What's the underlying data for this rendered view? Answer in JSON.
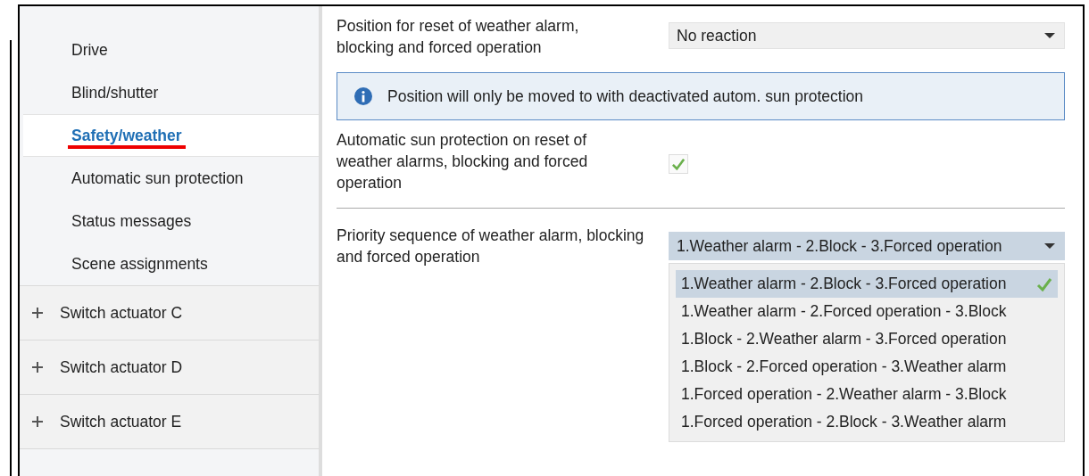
{
  "sidebar": {
    "items": [
      {
        "label": "Drive",
        "kind": "sub",
        "selected": false
      },
      {
        "label": "Blind/shutter",
        "kind": "sub",
        "selected": false
      },
      {
        "label": "Safety/weather",
        "kind": "sub",
        "selected": true
      },
      {
        "label": "Automatic sun protection",
        "kind": "sub",
        "selected": false
      },
      {
        "label": "Status messages",
        "kind": "sub",
        "selected": false
      },
      {
        "label": "Scene assignments",
        "kind": "sub",
        "selected": false
      },
      {
        "label": "Switch actuator C",
        "kind": "group",
        "selected": false,
        "expanded": false
      },
      {
        "label": "Switch actuator D",
        "kind": "group",
        "selected": false,
        "expanded": false
      },
      {
        "label": "Switch actuator E",
        "kind": "group",
        "selected": false,
        "expanded": false
      }
    ]
  },
  "groups": [
    [
      {
        "kind": "dropdown",
        "label": "Position for reset of weather alarm, blocking and forced operation",
        "value": "No reaction",
        "open": false
      },
      {
        "kind": "info",
        "text": "Position will only be moved to with deactivated autom. sun protection"
      },
      {
        "kind": "checkbox",
        "label": "Automatic sun protection on reset of weather alarms, blocking and forced operation",
        "checked": true
      }
    ],
    [
      {
        "kind": "dropdown",
        "label": "Priority sequence of weather alarm, blocking and forced operation",
        "value": "1.Weather alarm - 2.Block - 3.Forced operation",
        "open": true,
        "options": [
          {
            "label": "1.Weather alarm - 2.Block - 3.Forced operation",
            "selected": true
          },
          {
            "label": "1.Weather alarm - 2.Forced operation - 3.Block",
            "selected": false
          },
          {
            "label": "1.Block - 2.Weather alarm - 3.Forced operation",
            "selected": false
          },
          {
            "label": "1.Block - 2.Forced operation - 3.Weather alarm",
            "selected": false
          },
          {
            "label": "1.Forced operation - 2.Weather alarm - 3.Block",
            "selected": false
          },
          {
            "label": "1.Forced operation - 2.Block - 3.Weather alarm",
            "selected": false
          }
        ]
      }
    ]
  ]
}
